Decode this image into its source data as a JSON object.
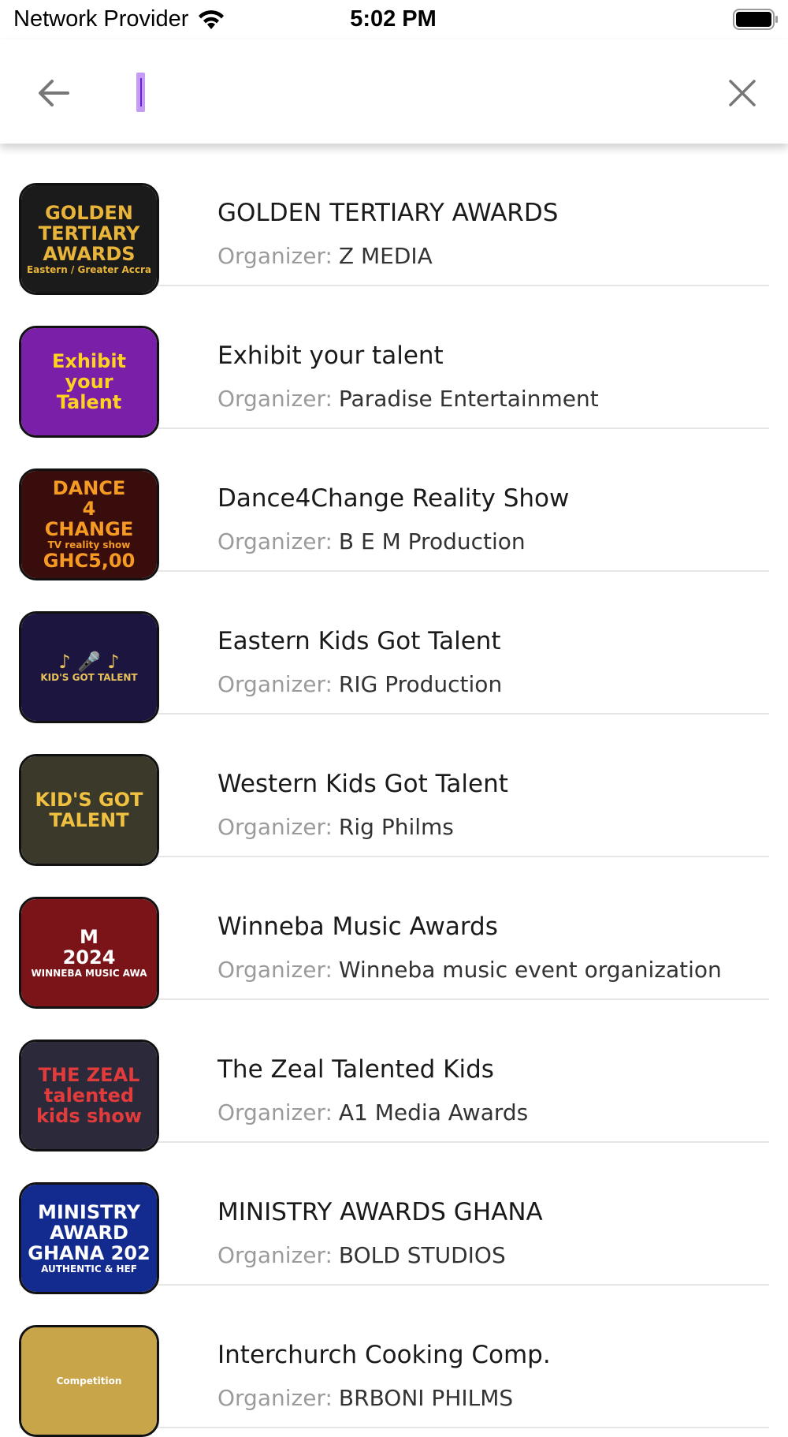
{
  "status_bar": {
    "carrier": "Network Provider",
    "time": "5:02 PM",
    "icons": [
      "wifi-icon",
      "battery-icon"
    ]
  },
  "search": {
    "value": "",
    "placeholder": "",
    "icons": [
      "back-arrow-icon",
      "close-icon"
    ]
  },
  "organizer_label": "Organizer:",
  "events": [
    {
      "title": "GOLDEN TERTIARY AWARDS",
      "organizer": "Z MEDIA",
      "thumb_lines": [
        "GOLDEN",
        "TERTIARY",
        "AWARDS",
        "Eastern / Greater Accra"
      ],
      "thumb_bg": "#1b1b1b",
      "thumb_fg": "#e8b43a"
    },
    {
      "title": "Exhibit your talent",
      "organizer": "Paradise Entertainment",
      "thumb_lines": [
        "Exhibit",
        "your",
        "Talent"
      ],
      "thumb_bg": "#7a1fa8",
      "thumb_fg": "#ffd21f"
    },
    {
      "title": "Dance4Change Reality Show",
      "organizer": "B E M Production",
      "thumb_lines": [
        "DANCE",
        "4",
        "CHANGE",
        "TV reality show",
        "GHC5,00"
      ],
      "thumb_bg": "#3a0d0d",
      "thumb_fg": "#f59a23"
    },
    {
      "title": "Eastern Kids Got Talent",
      "organizer": "RIG Production",
      "thumb_lines": [
        "♪ 🎤 ♪",
        "KID'S GOT TALENT"
      ],
      "thumb_bg": "#1c1540",
      "thumb_fg": "#e6c15a"
    },
    {
      "title": "Western Kids Got Talent",
      "organizer": "Rig Philms",
      "thumb_lines": [
        "KID'S GOT",
        "TALENT"
      ],
      "thumb_bg": "#3b3a2a",
      "thumb_fg": "#f0c040"
    },
    {
      "title": "Winneba Music Awards",
      "organizer": "Winneba music event organization",
      "thumb_lines": [
        "M",
        "2024",
        "WINNEBA MUSIC AWA"
      ],
      "thumb_bg": "#7a1418",
      "thumb_fg": "#ffffff"
    },
    {
      "title": "The Zeal Talented Kids",
      "organizer": "A1 Media Awards",
      "thumb_lines": [
        "THE ZEAL",
        "talented",
        "kids show"
      ],
      "thumb_bg": "#2c2a3a",
      "thumb_fg": "#e23b3b"
    },
    {
      "title": "MINISTRY AWARDS GHANA",
      "organizer": "BOLD STUDIOS",
      "thumb_lines": [
        "MINISTRY",
        "AWARD",
        "GHANA 202",
        "AUTHENTIC & HEF"
      ],
      "thumb_bg": "#132a8f",
      "thumb_fg": "#ffffff"
    },
    {
      "title": "Interchurch Cooking Comp.",
      "organizer": "BRBONI PHILMS",
      "thumb_lines": [
        "Competition"
      ],
      "thumb_bg": "#c9a54a",
      "thumb_fg": "#ffffff"
    }
  ],
  "colors": {
    "divider": "#e6e6e6",
    "label_gray": "#9b9b9b",
    "caret_highlight": "#c49bf5"
  }
}
